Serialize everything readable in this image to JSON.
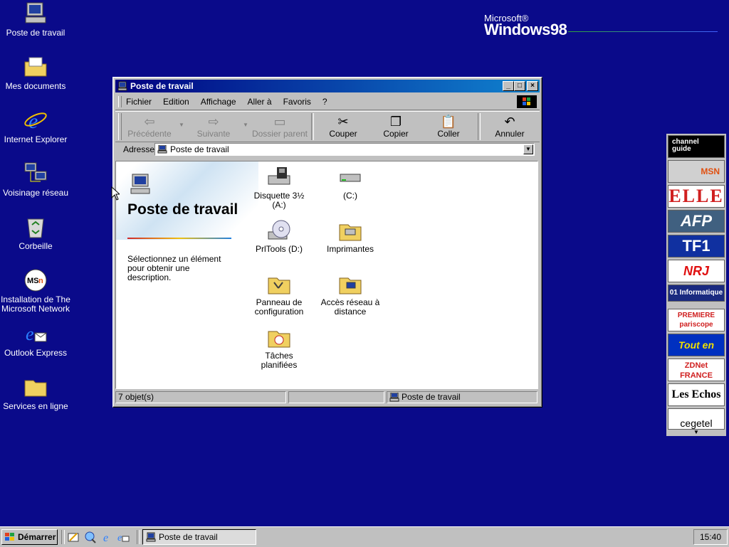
{
  "desktop": {
    "icons": [
      {
        "label": "Poste de travail",
        "icon": "computer-icon"
      },
      {
        "label": "Mes documents",
        "icon": "folder-documents-icon"
      },
      {
        "label": "Internet Explorer",
        "icon": "internet-explorer-icon"
      },
      {
        "label": "Voisinage réseau",
        "icon": "network-icon"
      },
      {
        "label": "Corbeille",
        "icon": "recycle-bin-icon"
      },
      {
        "label": "Installation de The Microsoft Network",
        "icon": "msn-icon"
      },
      {
        "label": "Outlook Express",
        "icon": "outlook-express-icon"
      },
      {
        "label": "Services en ligne",
        "icon": "folder-icon"
      }
    ],
    "logo": {
      "microsoft": "Microsoft®",
      "windows": "Windows98"
    }
  },
  "window": {
    "title": "Poste de travail",
    "menu": [
      "Fichier",
      "Edition",
      "Affichage",
      "Aller à",
      "Favoris",
      "?"
    ],
    "toolbar": {
      "back": "Précédente",
      "forward": "Suivante",
      "up": "Dossier parent",
      "cut": "Couper",
      "copy": "Copier",
      "paste": "Coller",
      "undo": "Annuler"
    },
    "address": {
      "label": "Adresse",
      "value": "Poste de travail"
    },
    "webview": {
      "title": "Poste de travail",
      "description": "Sélectionnez un élément pour obtenir une description."
    },
    "items": [
      {
        "label": "Disquette 3½ (A:)",
        "icon": "floppy-drive-icon"
      },
      {
        "label": "(C:)",
        "icon": "hard-drive-icon"
      },
      {
        "label": "PrlTools (D:)",
        "icon": "cd-drive-icon"
      },
      {
        "label": "Imprimantes",
        "icon": "printers-folder-icon"
      },
      {
        "label": "Panneau de configuration",
        "icon": "control-panel-icon"
      },
      {
        "label": "Accès réseau à distance",
        "icon": "dialup-network-icon"
      },
      {
        "label": "Tâches planifiées",
        "icon": "scheduled-tasks-icon"
      }
    ],
    "status": {
      "count": "7 objet(s)",
      "location": "Poste de travail"
    }
  },
  "channels": [
    {
      "label": "channel guide",
      "color": "#000000"
    },
    {
      "label": "MSN",
      "color": "#d0d0d0"
    },
    {
      "label": "ELLE",
      "color": "#ffffff"
    },
    {
      "label": "AFP",
      "color": "#406080"
    },
    {
      "label": "TF1",
      "color": "#1030a0"
    },
    {
      "label": "NRJ",
      "color": "#ffffff"
    },
    {
      "label": "01 Informatique",
      "color": "#1a2a80"
    },
    {
      "label": "PREMIERE pariscope",
      "color": "#ffffff"
    },
    {
      "label": "Tout en ville",
      "color": "#0030c0"
    },
    {
      "label": "ZDNet FRANCE",
      "color": "#ffffff"
    },
    {
      "label": "Les Echos",
      "color": "#ffffff"
    },
    {
      "label": "cegetel",
      "color": "#ffffff"
    }
  ],
  "taskbar": {
    "start": "Démarrer",
    "task": "Poste de travail",
    "clock": "15:40"
  }
}
